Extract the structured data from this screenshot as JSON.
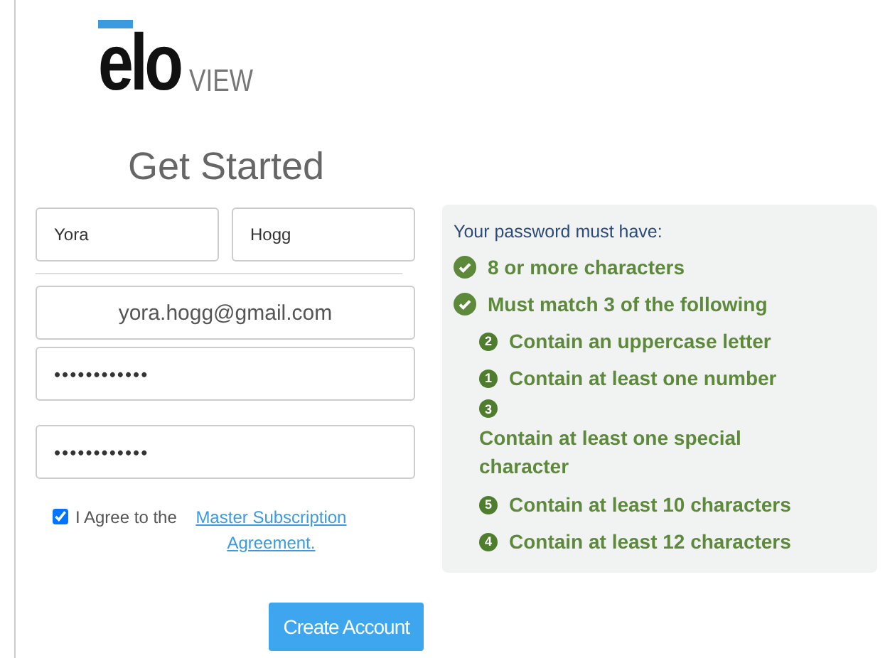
{
  "logo": {
    "wordmark": "elo",
    "product": "VIEW"
  },
  "heading": "Get Started",
  "form": {
    "first_name": "Yora",
    "last_name": "Hogg",
    "email": "yora.hogg@gmail.com",
    "password": "••••••••••••",
    "confirm_password": "••••••••••••",
    "agree": {
      "checked": true,
      "text": "I Agree to the ",
      "link": "Master Subscription Agreement."
    },
    "submit": "Create Account"
  },
  "requirements": {
    "title": "Your password must have:",
    "items": [
      {
        "kind": "check",
        "text": "8 or more characters",
        "stacked": false
      },
      {
        "kind": "check",
        "text": "Must match 3 of the following",
        "stacked": false
      },
      {
        "kind": "number",
        "badge": "2",
        "text": "Contain an uppercase letter",
        "stacked": false
      },
      {
        "kind": "number",
        "badge": "1",
        "text": "Contain at least one number",
        "stacked": false
      },
      {
        "kind": "number",
        "badge": "3",
        "text": "Contain at least one special character",
        "stacked": true
      },
      {
        "kind": "number",
        "badge": "5",
        "text": "Contain at least 10 characters",
        "stacked": false
      },
      {
        "kind": "number",
        "badge": "4",
        "text": "Contain at least 12 characters",
        "stacked": false
      }
    ]
  }
}
